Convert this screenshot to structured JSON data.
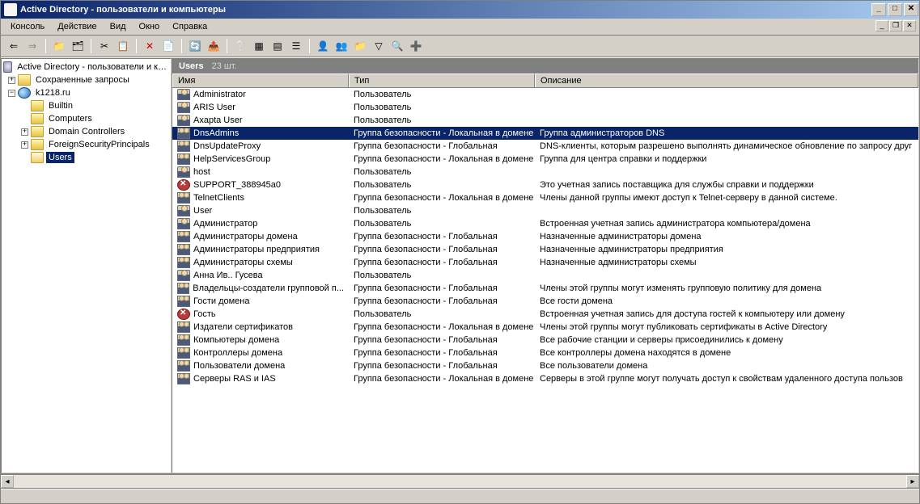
{
  "window": {
    "title": "Active Directory - пользователи и компьютеры"
  },
  "menu": {
    "items": [
      "Консоль",
      "Действие",
      "Вид",
      "Окно",
      "Справка"
    ]
  },
  "tree": {
    "root": "Active Directory - пользователи и к…",
    "saved_queries": "Сохраненные запросы",
    "domain": "k1218.ru",
    "builtin": "Builtin",
    "computers": "Computers",
    "domain_controllers": "Domain Controllers",
    "fsp": "ForeignSecurityPrincipals",
    "users": "Users"
  },
  "list": {
    "heading": "Users",
    "count": "23 шт.",
    "columns": {
      "name": "Имя",
      "type": "Тип",
      "desc": "Описание"
    },
    "rows": [
      {
        "icon": "user",
        "name": "Administrator",
        "type": "Пользователь",
        "desc": ""
      },
      {
        "icon": "user",
        "name": "ARIS User",
        "type": "Пользователь",
        "desc": ""
      },
      {
        "icon": "user",
        "name": "Axapta User",
        "type": "Пользователь",
        "desc": ""
      },
      {
        "icon": "group",
        "name": "DnsAdmins",
        "type": "Группа безопасности - Локальная в домене",
        "desc": "Группа администраторов DNS",
        "selected": true
      },
      {
        "icon": "group",
        "name": "DnsUpdateProxy",
        "type": "Группа безопасности - Глобальная",
        "desc": "DNS-клиенты, которым разрешено выполнять динамическое обновление по запросу друг"
      },
      {
        "icon": "group",
        "name": "HelpServicesGroup",
        "type": "Группа безопасности - Локальная в домене",
        "desc": "Группа для центра справки и поддержки"
      },
      {
        "icon": "user",
        "name": "host",
        "type": "Пользователь",
        "desc": ""
      },
      {
        "icon": "disabled",
        "name": "SUPPORT_388945a0",
        "type": "Пользователь",
        "desc": "Это учетная запись поставщика для службы справки и поддержки"
      },
      {
        "icon": "group",
        "name": "TelnetClients",
        "type": "Группа безопасности - Локальная в домене",
        "desc": "Члены данной группы имеют доступ к Telnet-серверу в данной системе."
      },
      {
        "icon": "user",
        "name": "User",
        "type": "Пользователь",
        "desc": ""
      },
      {
        "icon": "user",
        "name": "Администратор",
        "type": "Пользователь",
        "desc": "Встроенная учетная запись администратора компьютера/домена"
      },
      {
        "icon": "group",
        "name": "Администраторы домена",
        "type": "Группа безопасности - Глобальная",
        "desc": "Назначенные администраторы домена"
      },
      {
        "icon": "group",
        "name": "Администраторы предприятия",
        "type": "Группа безопасности - Глобальная",
        "desc": "Назначенные администраторы предприятия"
      },
      {
        "icon": "group",
        "name": "Администраторы схемы",
        "type": "Группа безопасности - Глобальная",
        "desc": "Назначенные администраторы схемы"
      },
      {
        "icon": "user",
        "name": "Анна Ив.. Гусева",
        "type": "Пользователь",
        "desc": ""
      },
      {
        "icon": "group",
        "name": "Владельцы-создатели групповой п...",
        "type": "Группа безопасности - Глобальная",
        "desc": "Члены этой группы могут изменять групповую политику для домена"
      },
      {
        "icon": "group",
        "name": "Гости домена",
        "type": "Группа безопасности - Глобальная",
        "desc": "Все гости домена"
      },
      {
        "icon": "disabled",
        "name": "Гость",
        "type": "Пользователь",
        "desc": "Встроенная учетная запись для доступа гостей к компьютеру или домену"
      },
      {
        "icon": "group",
        "name": "Издатели сертификатов",
        "type": "Группа безопасности - Локальная в домене",
        "desc": "Члены этой группы могут публиковать сертификаты в Active Directory"
      },
      {
        "icon": "group",
        "name": "Компьютеры домена",
        "type": "Группа безопасности - Глобальная",
        "desc": "Все рабочие станции и серверы присоединились к домену"
      },
      {
        "icon": "group",
        "name": "Контроллеры домена",
        "type": "Группа безопасности - Глобальная",
        "desc": "Все контроллеры домена находятся в домене"
      },
      {
        "icon": "group",
        "name": "Пользователи домена",
        "type": "Группа безопасности - Глобальная",
        "desc": "Все пользователи домена"
      },
      {
        "icon": "group",
        "name": "Серверы RAS и IAS",
        "type": "Группа безопасности - Локальная в домене",
        "desc": "Серверы в этой группе могут получать доступ к свойствам удаленного доступа пользов"
      }
    ]
  }
}
